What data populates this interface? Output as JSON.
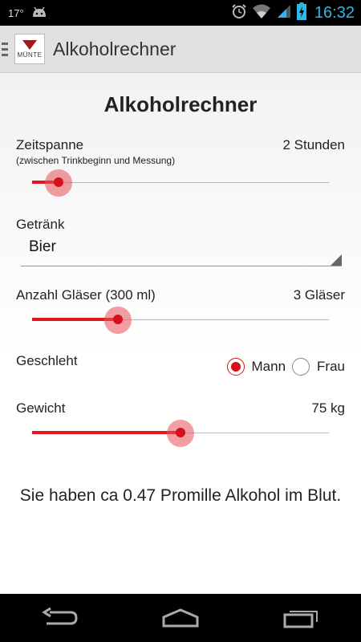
{
  "status_bar": {
    "temperature": "17°",
    "time": "16:32",
    "icons": [
      "android-debug-icon",
      "alarm-icon",
      "wifi-icon",
      "signal-icon",
      "battery-charging-icon"
    ]
  },
  "action_bar": {
    "logo_text": "MÜNTE",
    "title": "Alkoholrechner"
  },
  "page": {
    "title": "Alkoholrechner",
    "duration": {
      "label": "Zeitspanne",
      "sublabel": "(zwischen Trinkbeginn und Messung)",
      "value": "2 Stunden",
      "slider_fraction": 0.09
    },
    "drink": {
      "label": "Getränk",
      "selected": "Bier"
    },
    "glasses": {
      "label": "Anzahl Gläser (300 ml)",
      "value": "3 Gläser",
      "slider_fraction": 0.29
    },
    "gender": {
      "label": "Geschleht",
      "options": [
        {
          "label": "Mann",
          "checked": true
        },
        {
          "label": "Frau",
          "checked": false
        }
      ]
    },
    "weight": {
      "label": "Gewicht",
      "value": "75 kg",
      "slider_fraction": 0.5
    },
    "result": "Sie haben ca 0.47 Promille Alkohol im Blut."
  },
  "colors": {
    "accent": "#d5101a",
    "time": "#33b5e5"
  },
  "nav_bar": {
    "icons": [
      "back-icon",
      "home-icon",
      "recent-apps-icon"
    ]
  }
}
